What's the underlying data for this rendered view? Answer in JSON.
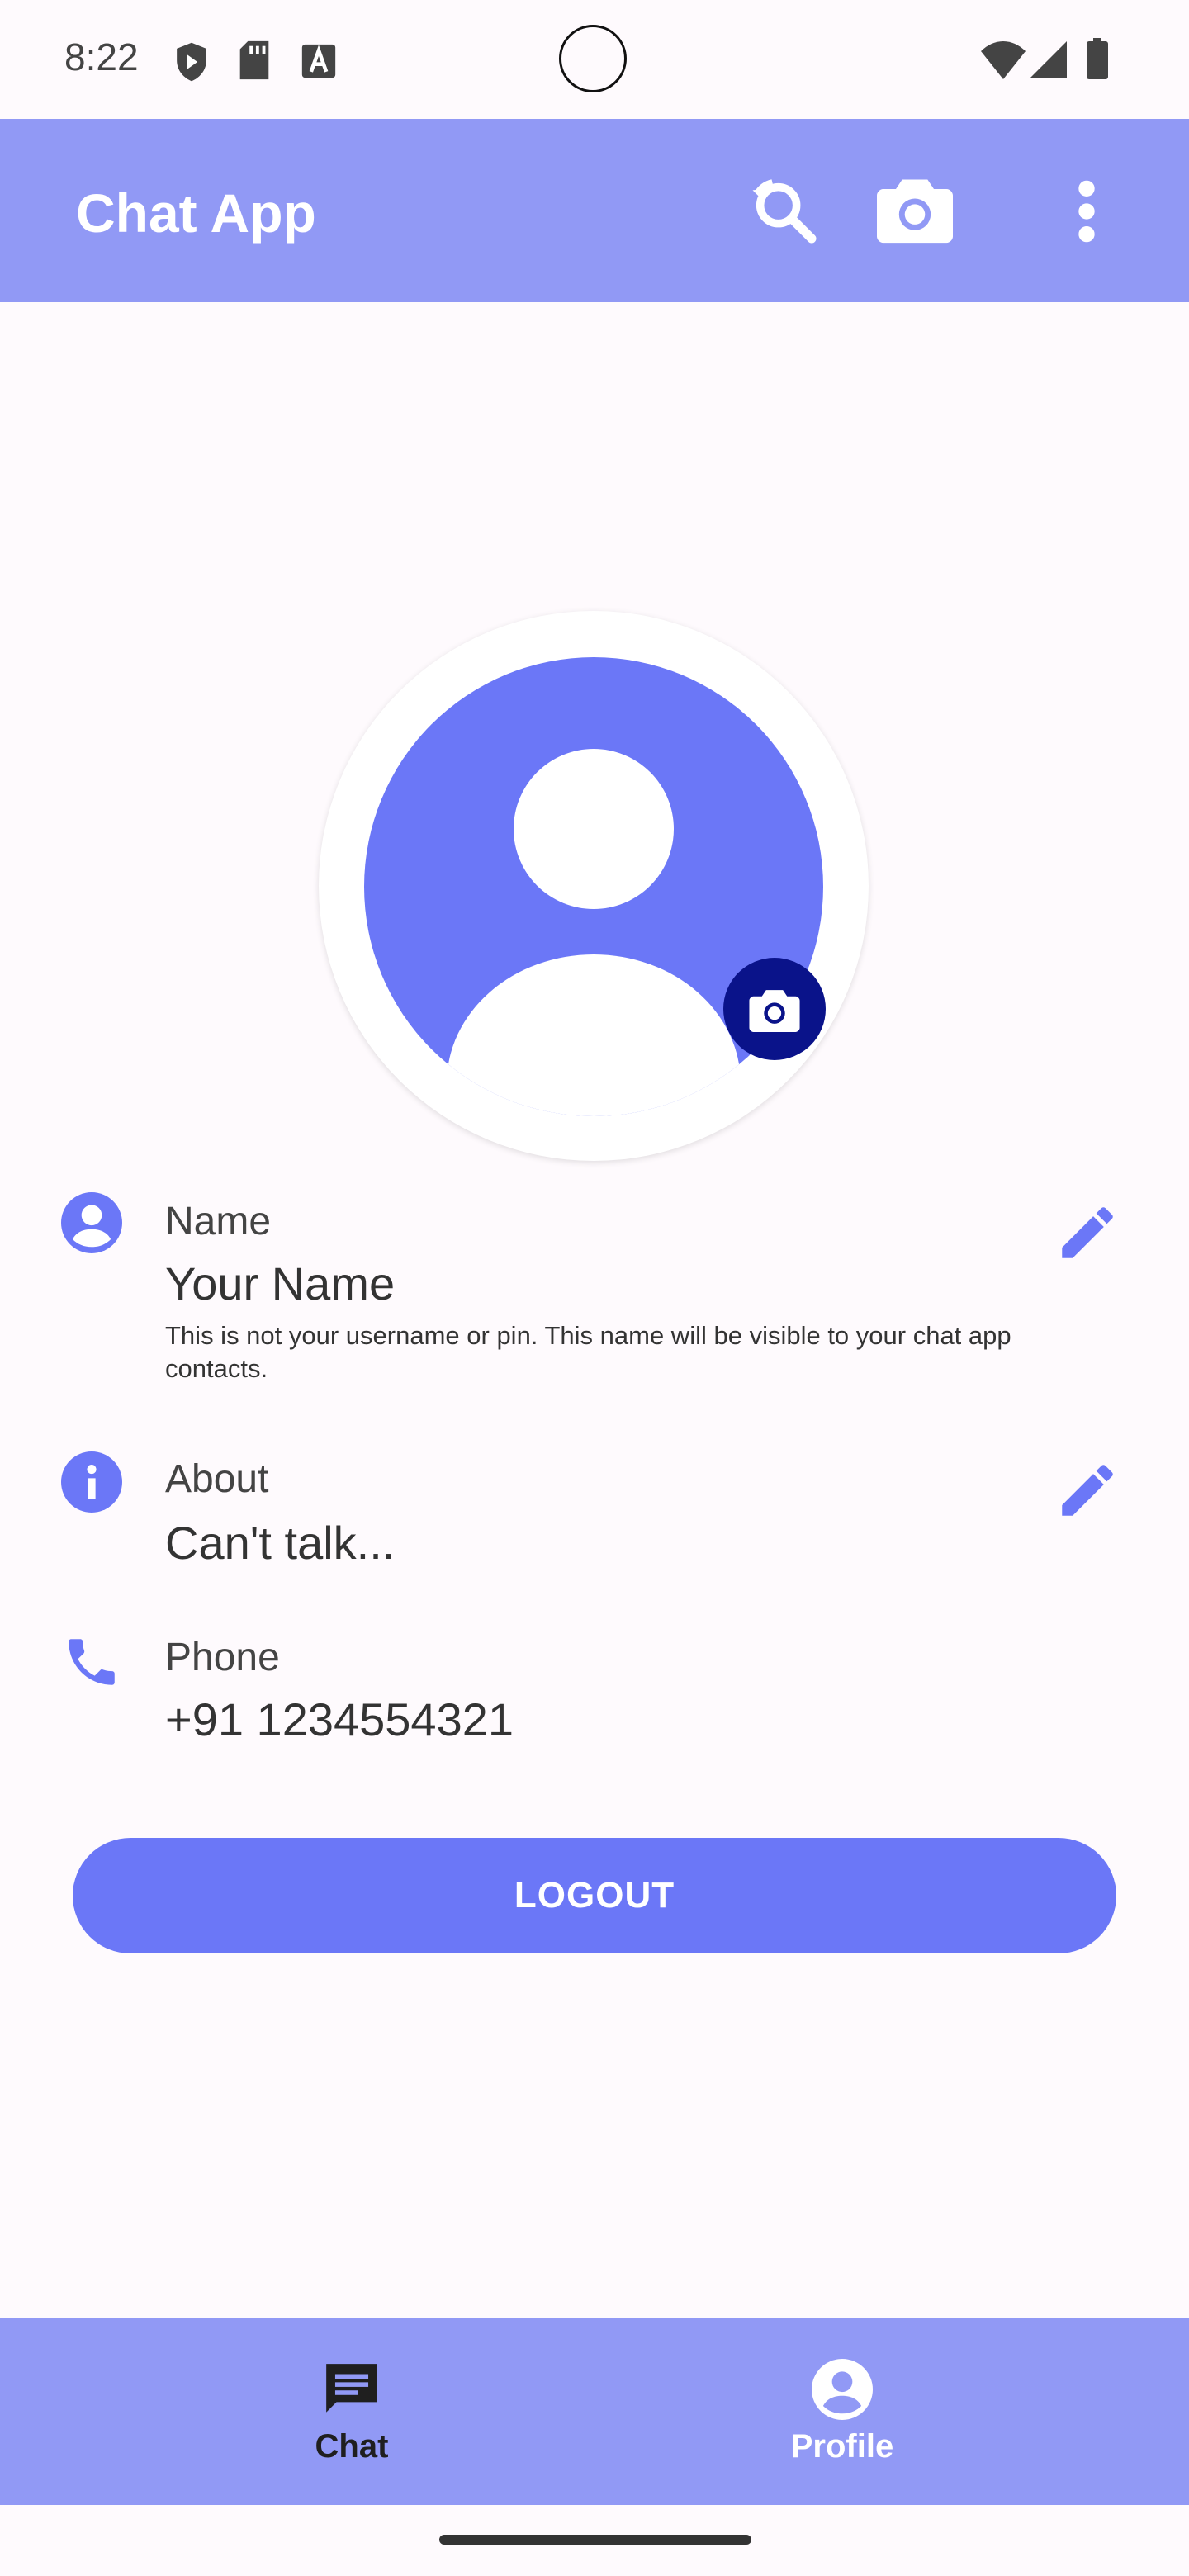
{
  "status_bar": {
    "time": "8:22",
    "icons": [
      "shield-play-icon",
      "sd-card-icon",
      "font-a-icon",
      "wifi-icon",
      "signal-icon",
      "battery-icon"
    ]
  },
  "app_bar": {
    "title": "Chat App",
    "actions": [
      "search-icon",
      "camera-icon",
      "more-vert-icon"
    ]
  },
  "profile": {
    "avatar_icon": "person-icon",
    "camera_button_icon": "camera-icon",
    "rows": [
      {
        "icon": "account-circle-icon",
        "label": "Name",
        "value": "Your Name",
        "hint": "This is not your username or pin. This name will be visible to your chat app contacts.",
        "editable": true
      },
      {
        "icon": "info-icon",
        "label": "About",
        "value": "Can't talk...",
        "editable": true
      },
      {
        "icon": "phone-icon",
        "label": "Phone",
        "value": "+91 1234554321",
        "editable": false
      }
    ],
    "logout_label": "LOGOUT"
  },
  "bottom_nav": {
    "items": [
      {
        "label": "Chat",
        "icon": "chat-icon",
        "selected": false
      },
      {
        "label": "Profile",
        "icon": "account-circle-icon",
        "selected": true
      }
    ]
  },
  "colors": {
    "app_bar": "#9199f5",
    "accent": "#6b77f7",
    "camera_button": "#0a138a",
    "background": "#fefafd"
  }
}
